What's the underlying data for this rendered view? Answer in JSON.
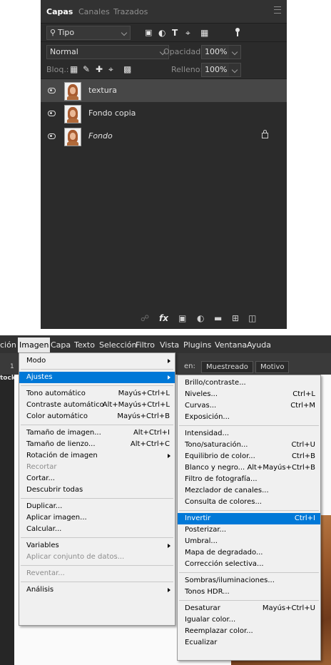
{
  "layers_panel": {
    "tabs": [
      "Capas",
      "Canales",
      "Trazados"
    ],
    "filter_label": "Tipo",
    "blend_mode": "Normal",
    "opacity_label": "Opacidad:",
    "opacity_value": "100%",
    "lock_label": "Bloq.:",
    "fill_label": "Relleno:",
    "fill_value": "100%",
    "layers": [
      {
        "name": "textura",
        "selected": true,
        "italic": false,
        "locked": false
      },
      {
        "name": "Fondo copia",
        "selected": false,
        "italic": false,
        "locked": false
      },
      {
        "name": "Fondo",
        "selected": false,
        "italic": true,
        "locked": true
      }
    ],
    "bottom_icons": [
      "link-icon",
      "fx-icon",
      "mask-icon",
      "adjustment-icon",
      "folder-icon",
      "new-layer-icon",
      "trash-icon"
    ],
    "fx_label": "fx"
  },
  "app": {
    "menubar": [
      "ción",
      "Imagen",
      "Capa",
      "Texto",
      "Selección",
      "Filtro",
      "Vista",
      "Plugins",
      "Ventana",
      "Ayuda"
    ],
    "active_menu": "Imagen",
    "options": {
      "muestreado": "Muestreado",
      "motivo": "Motivo",
      "left_fragment": "en:",
      "side_label": "tock",
      "side_number": "1"
    },
    "imagen_menu": [
      {
        "label": "Modo",
        "shortcut": "",
        "submenu": true
      },
      {
        "sep": true
      },
      {
        "label": "Ajustes",
        "shortcut": "",
        "submenu": true,
        "highlight": true
      },
      {
        "sep": true
      },
      {
        "label": "Tono automático",
        "shortcut": "Mayús+Ctrl+L"
      },
      {
        "label": "Contraste automático",
        "shortcut": "Alt+Mayús+Ctrl+L"
      },
      {
        "label": "Color automático",
        "shortcut": "Mayús+Ctrl+B"
      },
      {
        "sep": true
      },
      {
        "label": "Tamaño de imagen...",
        "shortcut": "Alt+Ctrl+I"
      },
      {
        "label": "Tamaño de lienzo...",
        "shortcut": "Alt+Ctrl+C"
      },
      {
        "label": "Rotación de imagen",
        "shortcut": "",
        "submenu": true
      },
      {
        "label": "Recortar",
        "shortcut": "",
        "disabled": true
      },
      {
        "label": "Cortar...",
        "shortcut": ""
      },
      {
        "label": "Descubrir todas",
        "shortcut": ""
      },
      {
        "sep": true
      },
      {
        "label": "Duplicar...",
        "shortcut": ""
      },
      {
        "label": "Aplicar imagen...",
        "shortcut": ""
      },
      {
        "label": "Calcular...",
        "shortcut": ""
      },
      {
        "sep": true
      },
      {
        "label": "Variables",
        "shortcut": "",
        "submenu": true
      },
      {
        "label": "Aplicar conjunto de datos...",
        "shortcut": "",
        "disabled": true
      },
      {
        "sep": true
      },
      {
        "label": "Reventar...",
        "shortcut": "",
        "disabled": true
      },
      {
        "sep": true
      },
      {
        "label": "Análisis",
        "shortcut": "",
        "submenu": true
      }
    ],
    "ajustes_menu": [
      {
        "label": "Brillo/contraste...",
        "shortcut": ""
      },
      {
        "label": "Niveles...",
        "shortcut": "Ctrl+L"
      },
      {
        "label": "Curvas...",
        "shortcut": "Ctrl+M"
      },
      {
        "label": "Exposición...",
        "shortcut": ""
      },
      {
        "sep": true
      },
      {
        "label": "Intensidad...",
        "shortcut": ""
      },
      {
        "label": "Tono/saturación...",
        "shortcut": "Ctrl+U"
      },
      {
        "label": "Equilibrio de color...",
        "shortcut": "Ctrl+B"
      },
      {
        "label": "Blanco y negro...",
        "shortcut": "Alt+Mayús+Ctrl+B"
      },
      {
        "label": "Filtro de fotografía...",
        "shortcut": ""
      },
      {
        "label": "Mezclador de canales...",
        "shortcut": ""
      },
      {
        "label": "Consulta de colores...",
        "shortcut": ""
      },
      {
        "sep": true
      },
      {
        "label": "Invertir",
        "shortcut": "Ctrl+I",
        "highlight": true
      },
      {
        "label": "Posterizar...",
        "shortcut": ""
      },
      {
        "label": "Umbral...",
        "shortcut": ""
      },
      {
        "label": "Mapa de degradado...",
        "shortcut": ""
      },
      {
        "label": "Corrección selectiva...",
        "shortcut": ""
      },
      {
        "sep": true
      },
      {
        "label": "Sombras/iluminaciones...",
        "shortcut": ""
      },
      {
        "label": "Tonos HDR...",
        "shortcut": ""
      },
      {
        "sep": true
      },
      {
        "label": "Desaturar",
        "shortcut": "Mayús+Ctrl+U"
      },
      {
        "label": "Igualar color...",
        "shortcut": ""
      },
      {
        "label": "Reemplazar color...",
        "shortcut": ""
      },
      {
        "label": "Ecualizar",
        "shortcut": ""
      }
    ]
  },
  "colors": {
    "highlight": "#0078d7",
    "panel_bg": "#2b2b2b",
    "menu_bg": "#f0f0f0"
  }
}
